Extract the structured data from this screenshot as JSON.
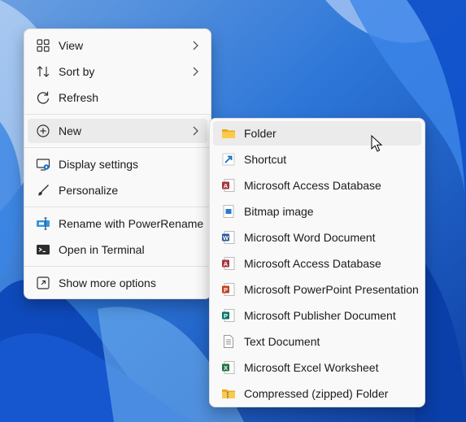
{
  "context_menu": {
    "items": [
      {
        "label": "View",
        "icon": "view-grid-icon",
        "has_submenu": true
      },
      {
        "label": "Sort by",
        "icon": "sort-icon",
        "has_submenu": true
      },
      {
        "label": "Refresh",
        "icon": "refresh-icon",
        "has_submenu": false
      },
      {
        "label": "New",
        "icon": "new-plus-icon",
        "has_submenu": true,
        "highlighted": true
      },
      {
        "label": "Display settings",
        "icon": "display-settings-icon",
        "has_submenu": false
      },
      {
        "label": "Personalize",
        "icon": "personalize-brush-icon",
        "has_submenu": false
      },
      {
        "label": "Rename with PowerRename",
        "icon": "powerrename-icon",
        "has_submenu": false
      },
      {
        "label": "Open in Terminal",
        "icon": "terminal-icon",
        "has_submenu": false
      },
      {
        "label": "Show more options",
        "icon": "show-more-options-icon",
        "has_submenu": false
      }
    ]
  },
  "new_submenu": {
    "items": [
      {
        "label": "Folder",
        "icon": "folder-icon",
        "highlighted": true
      },
      {
        "label": "Shortcut",
        "icon": "shortcut-arrow-icon"
      },
      {
        "label": "Microsoft Access Database",
        "icon": "access-database-icon"
      },
      {
        "label": "Bitmap image",
        "icon": "bitmap-image-icon"
      },
      {
        "label": "Microsoft Word Document",
        "icon": "word-document-icon"
      },
      {
        "label": "Microsoft Access Database",
        "icon": "access-database-icon"
      },
      {
        "label": "Microsoft PowerPoint Presentation",
        "icon": "powerpoint-presentation-icon"
      },
      {
        "label": "Microsoft Publisher Document",
        "icon": "publisher-document-icon"
      },
      {
        "label": "Text Document",
        "icon": "text-document-icon"
      },
      {
        "label": "Microsoft Excel Worksheet",
        "icon": "excel-worksheet-icon"
      },
      {
        "label": "Compressed (zipped) Folder",
        "icon": "zipped-folder-icon"
      }
    ]
  },
  "colors": {
    "menu_background": "#f9f9f9",
    "highlight": "#ebebeb",
    "wallpaper_blue": "#0a56d6",
    "access": "#a4373a",
    "word": "#2b579a",
    "powerpoint": "#c43e1c",
    "publisher": "#077568",
    "excel": "#217346"
  }
}
